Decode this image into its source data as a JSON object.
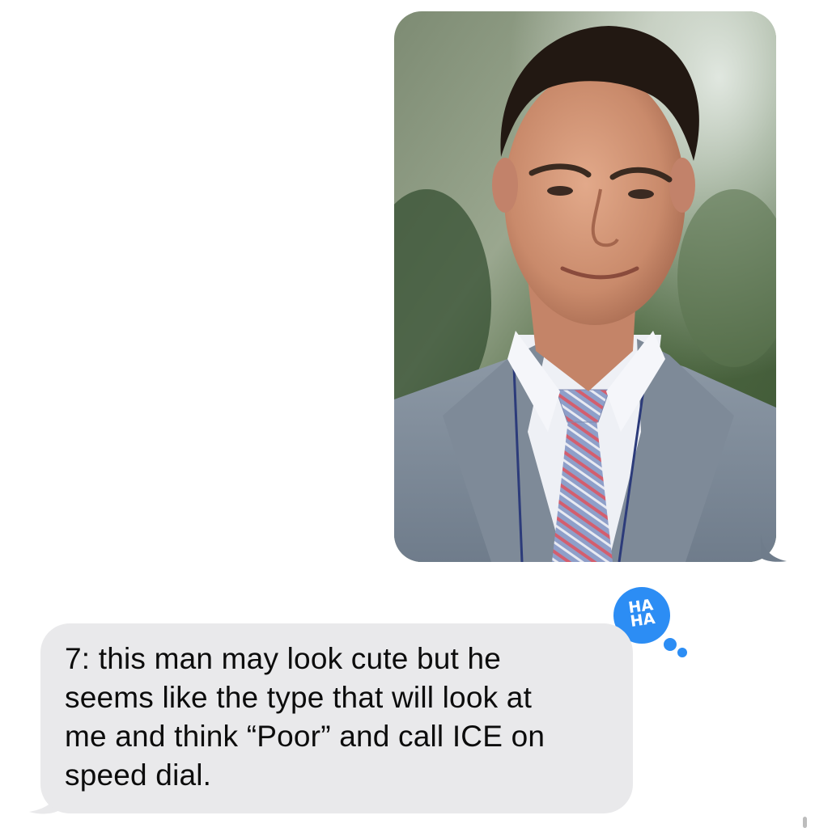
{
  "conversation": {
    "messages": [
      {
        "direction": "sent",
        "type": "image",
        "image_subject": "man in grey suit with striped tie"
      },
      {
        "direction": "received",
        "type": "text",
        "text": "7: this man may look cute but he\nseems like the type that will look at\nme and think “Poor” and call ICE on\nspeed dial.",
        "reaction": {
          "type": "haha",
          "line1": "HA",
          "line2": "HA"
        }
      }
    ]
  },
  "colors": {
    "received_bubble": "#e9e9eb",
    "reaction_blue": "#2c8df4",
    "background": "#ffffff"
  },
  "icons": {
    "reaction": "haha-tapback-icon"
  }
}
